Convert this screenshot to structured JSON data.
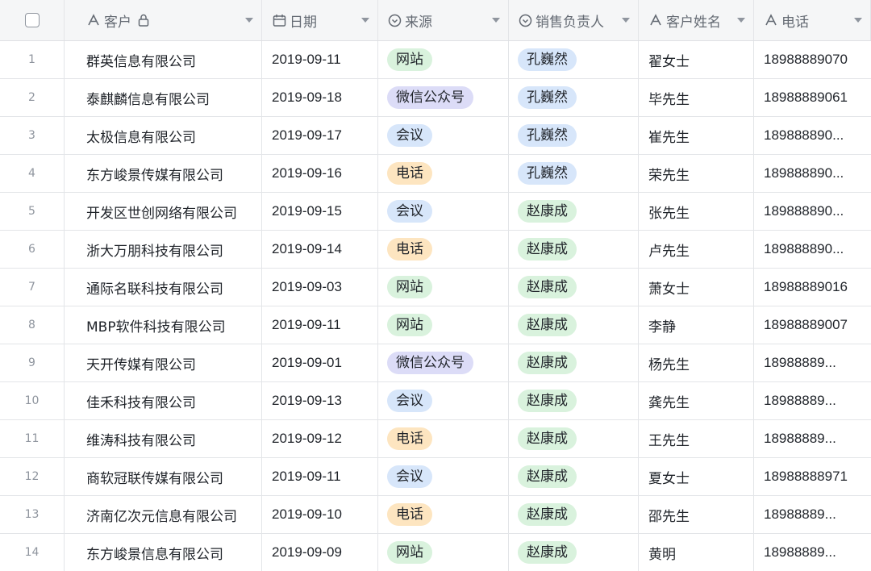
{
  "columns": [
    {
      "label": "",
      "icon": "checkbox"
    },
    {
      "label": "客户",
      "icon": "text-field-icon"
    },
    {
      "label": "日期",
      "icon": "calendar-icon"
    },
    {
      "label": "来源",
      "icon": "single-select-icon"
    },
    {
      "label": "销售负责人",
      "icon": "single-select-icon"
    },
    {
      "label": "客户姓名",
      "icon": "text-field-icon"
    },
    {
      "label": "电话",
      "icon": "text-field-icon"
    }
  ],
  "tag_colors": {
    "网站": "#d9f2dd",
    "微信公众号": "#dcdcf7",
    "会议": "#d7e6fa",
    "电话": "#fde5c0",
    "孔巍然": "#d7e6fa",
    "赵康成": "#d9f2dd"
  },
  "rows": [
    {
      "idx": "1",
      "customer": "群英信息有限公司",
      "date": "2019-09-11",
      "source": "网站",
      "owner": "孔巍然",
      "name": "翟女士",
      "phone": "18988889070"
    },
    {
      "idx": "2",
      "customer": "泰麒麟信息有限公司",
      "date": "2019-09-18",
      "source": "微信公众号",
      "owner": "孔巍然",
      "name": "毕先生",
      "phone": "18988889061"
    },
    {
      "idx": "3",
      "customer": "太极信息有限公司",
      "date": "2019-09-17",
      "source": "会议",
      "owner": "孔巍然",
      "name": "崔先生",
      "phone": "189888890..."
    },
    {
      "idx": "4",
      "customer": "东方峻景传媒有限公司",
      "date": "2019-09-16",
      "source": "电话",
      "owner": "孔巍然",
      "name": "荣先生",
      "phone": "189888890..."
    },
    {
      "idx": "5",
      "customer": "开发区世创网络有限公司",
      "date": "2019-09-15",
      "source": "会议",
      "owner": "赵康成",
      "name": "张先生",
      "phone": "189888890..."
    },
    {
      "idx": "6",
      "customer": "浙大万朋科技有限公司",
      "date": "2019-09-14",
      "source": "电话",
      "owner": "赵康成",
      "name": "卢先生",
      "phone": "189888890..."
    },
    {
      "idx": "7",
      "customer": "通际名联科技有限公司",
      "date": "2019-09-03",
      "source": "网站",
      "owner": "赵康成",
      "name": "萧女士",
      "phone": "18988889016"
    },
    {
      "idx": "8",
      "customer": "MBP软件科技有限公司",
      "date": "2019-09-11",
      "source": "网站",
      "owner": "赵康成",
      "name": "李静",
      "phone": "18988889007"
    },
    {
      "idx": "9",
      "customer": "天开传媒有限公司",
      "date": "2019-09-01",
      "source": "微信公众号",
      "owner": "赵康成",
      "name": "杨先生",
      "phone": "18988889..."
    },
    {
      "idx": "10",
      "customer": "佳禾科技有限公司",
      "date": "2019-09-13",
      "source": "会议",
      "owner": "赵康成",
      "name": "龚先生",
      "phone": "18988889..."
    },
    {
      "idx": "11",
      "customer": "维涛科技有限公司",
      "date": "2019-09-12",
      "source": "电话",
      "owner": "赵康成",
      "name": "王先生",
      "phone": "18988889..."
    },
    {
      "idx": "12",
      "customer": "商软冠联传媒有限公司",
      "date": "2019-09-11",
      "source": "会议",
      "owner": "赵康成",
      "name": "夏女士",
      "phone": "18988888971"
    },
    {
      "idx": "13",
      "customer": "济南亿次元信息有限公司",
      "date": "2019-09-10",
      "source": "电话",
      "owner": "赵康成",
      "name": "邵先生",
      "phone": "18988889..."
    },
    {
      "idx": "14",
      "customer": "东方峻景信息有限公司",
      "date": "2019-09-09",
      "source": "网站",
      "owner": "赵康成",
      "name": "黄明",
      "phone": "18988889..."
    }
  ]
}
